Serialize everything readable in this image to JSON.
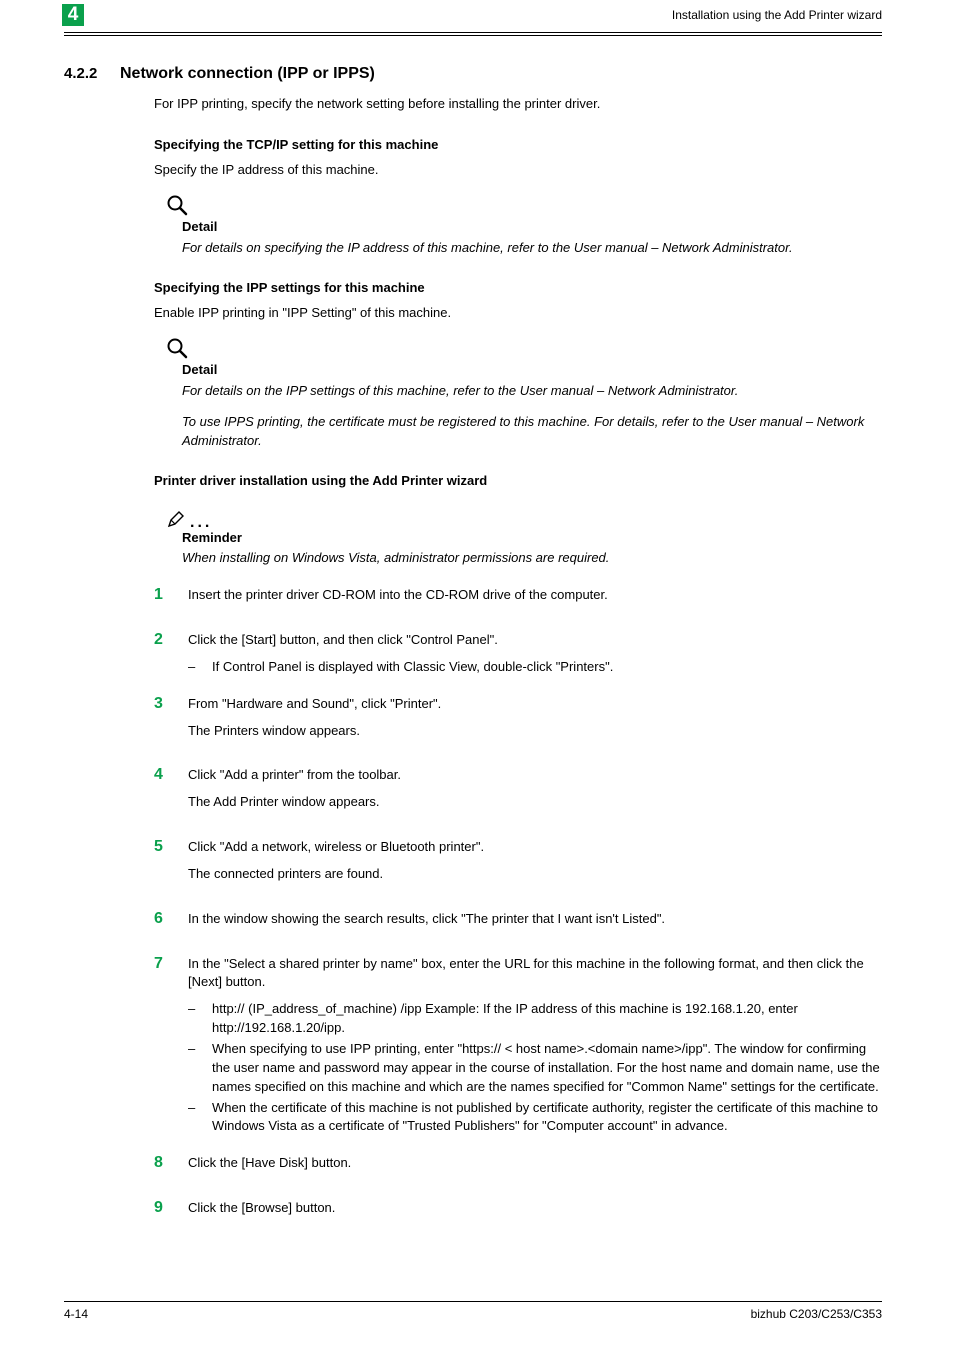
{
  "header": {
    "chapter_number": "4",
    "right_text": "Installation using the Add Printer wizard"
  },
  "section": {
    "number": "4.2.2",
    "title": "Network connection (IPP or IPPS)",
    "intro": "For IPP printing, specify the network setting before installing the printer driver."
  },
  "tcpip": {
    "heading": "Specifying the TCP/IP setting for this machine",
    "body": "Specify the IP address of this machine.",
    "note_title": "Detail",
    "note_body": "For details on specifying the IP address of this machine, refer to the User manual – Network Administrator."
  },
  "ipp": {
    "heading": "Specifying the IPP settings for this machine",
    "body": "Enable IPP printing in \"IPP Setting\" of this machine.",
    "note_title": "Detail",
    "note_body1": "For details on the IPP settings of this machine, refer to the User manual – Network Administrator.",
    "note_body2": "To use IPPS printing, the certificate must be registered to this machine. For details, refer to the User manual – Network Administrator."
  },
  "install": {
    "heading": "Printer driver installation using the Add Printer wizard",
    "reminder_title": "Reminder",
    "reminder_body": "When installing on Windows Vista, administrator permissions are required."
  },
  "steps": [
    {
      "n": "1",
      "lines": [
        "Insert the printer driver CD-ROM into the CD-ROM drive of the computer."
      ],
      "subs": []
    },
    {
      "n": "2",
      "lines": [
        "Click the [Start] button, and then click \"Control Panel\"."
      ],
      "subs": [
        "If Control Panel is displayed with Classic View, double-click \"Printers\"."
      ]
    },
    {
      "n": "3",
      "lines": [
        "From \"Hardware and Sound\", click \"Printer\".",
        "The Printers window appears."
      ],
      "subs": []
    },
    {
      "n": "4",
      "lines": [
        "Click \"Add a printer\" from the toolbar.",
        "The Add Printer window appears."
      ],
      "subs": []
    },
    {
      "n": "5",
      "lines": [
        "Click \"Add a network, wireless or Bluetooth printer\".",
        "The connected printers are found."
      ],
      "subs": []
    },
    {
      "n": "6",
      "lines": [
        "In the window showing the search results, click \"The printer that I want isn't Listed\"."
      ],
      "subs": []
    },
    {
      "n": "7",
      "lines": [
        "In the \"Select a shared printer by name\" box, enter the URL for this machine in the following format, and then click the [Next] button."
      ],
      "subs": [
        "http:// (IP_address_of_machine) /ipp Example: If the IP address of this machine is 192.168.1.20, enter http://192.168.1.20/ipp.",
        "When specifying to use IPP printing, enter \"https:// < host name>.<domain name>/ipp\". The window for confirming the user name and password may appear in the course of installation. For the host name and domain name, use the names specified on this machine and which are the names specified for \"Common Name\" settings for the certificate.",
        "When the certificate of this machine is not published by certificate authority, register the certificate of this machine to Windows Vista as a certificate of \"Trusted Publishers\" for \"Computer account\" in advance."
      ]
    },
    {
      "n": "8",
      "lines": [
        "Click the [Have Disk] button."
      ],
      "subs": []
    },
    {
      "n": "9",
      "lines": [
        "Click the [Browse] button."
      ],
      "subs": []
    }
  ],
  "footer": {
    "left": "4-14",
    "right": "bizhub C203/C253/C353"
  }
}
